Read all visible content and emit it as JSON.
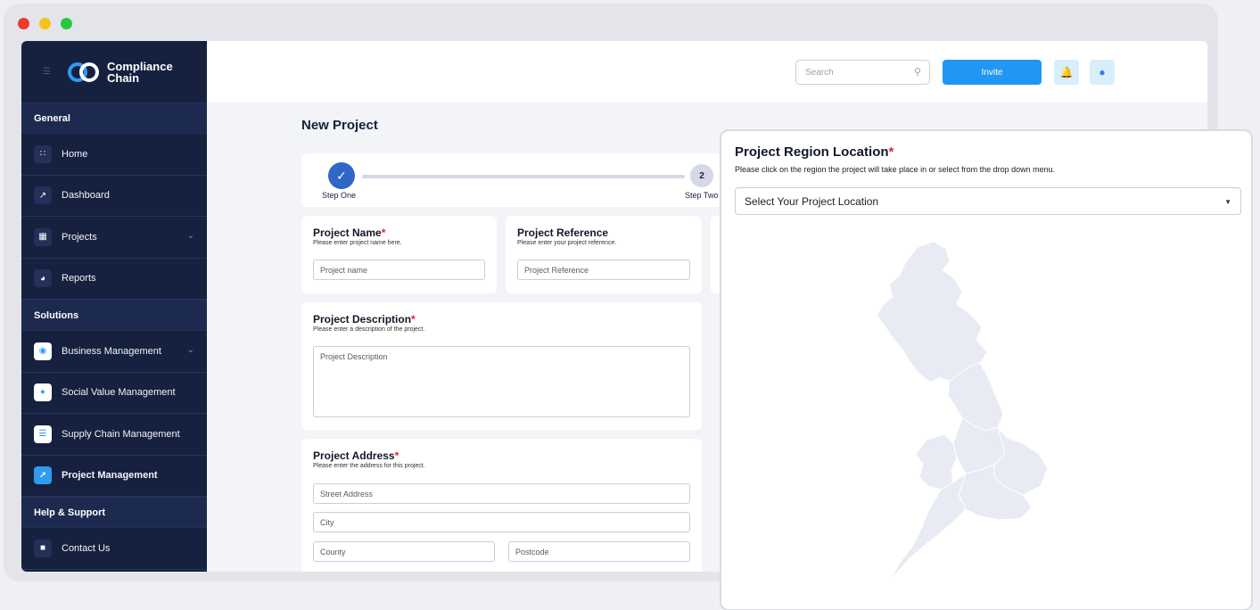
{
  "sidebar": {
    "brand": {
      "line1": "Compliance",
      "line2": "Chain"
    },
    "sections": {
      "general": "General",
      "solutions": "Solutions",
      "help": "Help & Support"
    },
    "general_items": [
      "Home",
      "Dashboard",
      "Projects",
      "Reports"
    ],
    "solution_items": [
      "Business Management",
      "Social Value Management",
      "Supply Chain Management",
      "Project Management"
    ],
    "help_items": [
      "Contact Us"
    ]
  },
  "topbar": {
    "search_placeholder": "Search",
    "invite_label": "Invite"
  },
  "main": {
    "title": "New Project",
    "stepper": {
      "step1_label": "Step One",
      "step2_number": "2",
      "step2_label": "Step Two"
    },
    "project_name": {
      "title": "Project Name",
      "hint": "Please enter project name here.",
      "placeholder": "Project name"
    },
    "project_reference": {
      "title": "Project Reference",
      "hint": "Please enter your project reference.",
      "placeholder": "Project Reference"
    },
    "project_description": {
      "title": "Project Description",
      "hint": "Please enter a description of the project.",
      "placeholder": "Project Description"
    },
    "project_address": {
      "title": "Project Address",
      "hint": "Please enter the address for this project.",
      "street": "Street Address",
      "city": "City",
      "county": "County",
      "postcode": "Postcode"
    }
  },
  "region_panel": {
    "title": "Project Region Location",
    "subtitle": "Please click on the region the project will take place in or select from the drop down menu.",
    "select_value": "Select Your Project Location"
  },
  "colors": {
    "sidebar_bg": "#16213f",
    "accent": "#2196f3",
    "required": "#e01e3c",
    "map_fill": "#e8eaf4"
  }
}
